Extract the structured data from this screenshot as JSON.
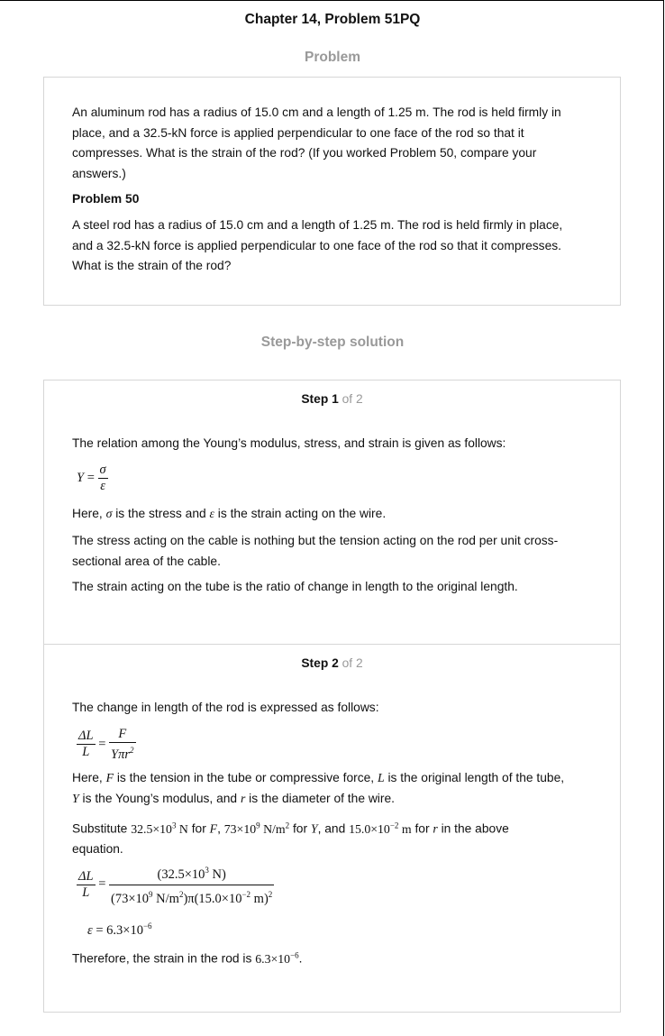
{
  "title": "Chapter 14, Problem 51PQ",
  "problem_heading": "Problem",
  "problem": {
    "text_line1": "An aluminum rod has a radius of 15.0 cm and a length of 1.25 m. The rod is held firmly in",
    "text_line2": "place, and a 32.5-kN force is applied perpendicular to one face of the rod so that it",
    "text_line3": "compresses. What is the strain of the rod? (If you worked Problem 50, compare your",
    "text_line4": "answers.)",
    "ref_heading": "Problem 50",
    "ref_line1": "A steel rod has a radius of 15.0 cm and a length of 1.25 m. The rod is held firmly in place,",
    "ref_line2": "and a 32.5-kN force is applied perpendicular to one face of the rod so that it compresses.",
    "ref_line3": "What is the strain of the rod?"
  },
  "solution_heading": "Step-by-step solution",
  "step1": {
    "label": "Step 1",
    "of": "of 2",
    "intro": "The relation among the Young’s modulus, stress, and strain is given as follows:",
    "eq_lhs": "Y",
    "eq_num": "σ",
    "eq_den": "ε",
    "here_a": "Here, ",
    "here_sym1": "σ",
    "here_b": " is the stress and ",
    "here_sym2": "ε",
    "here_c": " is the strain acting on the wire.",
    "stress_line1": "The stress acting on the cable is nothing but the tension acting on the rod per unit cross-",
    "stress_line2": "sectional area of the cable.",
    "strain_line": "The strain acting on the tube is the ratio of change in length to the original length."
  },
  "step2": {
    "label": "Step 2",
    "of": "of 2",
    "intro": "The change in length of the rod is expressed as follows:",
    "eq1_num_l": "ΔL",
    "eq1_den_l": "L",
    "eq1_num_r": "F",
    "eq1_den_r": "Yπr",
    "here_a": "Here, ",
    "sym_F": "F",
    "here_b": " is the tension in the tube or compressive force, ",
    "sym_L": "L",
    "here_c": " is the original length of the tube,",
    "sym_Y": "Y",
    "here_d": " is the Young’s modulus, and ",
    "sym_r": "r",
    "here_e": " is the diameter of the wire.",
    "sub_a": "Substitute ",
    "val_F": "32.5×10",
    "val_F_exp": "3",
    "val_F_unit": " N",
    "sub_for1": " for ",
    "sub_sep1": ", ",
    "val_Y": "73×10",
    "val_Y_exp": "9",
    "val_Y_unit": " N/m",
    "sub_for2": " for ",
    "sub_sep2": ", and ",
    "val_r": "15.0×10",
    "val_r_exp": "−2",
    "val_r_unit": " m",
    "sub_for3": " for ",
    "sub_tail": " in the above",
    "sub_line2": "equation.",
    "eq2_num": "(32.5×10",
    "eq2_num_exp": "3",
    "eq2_num_tail": " N)",
    "eq2_den_a": "(73×10",
    "eq2_den_a_exp": "9",
    "eq2_den_a_tail": " N/m",
    "eq2_den_b": ")π(15.0×10",
    "eq2_den_b_exp": "−2",
    "eq2_den_b_tail": " m)",
    "result_lhs": "ε",
    "result_val": " = 6.3×10",
    "result_exp": "−6",
    "conclusion": "Therefore, the strain in the rod is ",
    "conclusion_val": "6.3×10",
    "conclusion_exp": "−6",
    "conclusion_end": "."
  }
}
